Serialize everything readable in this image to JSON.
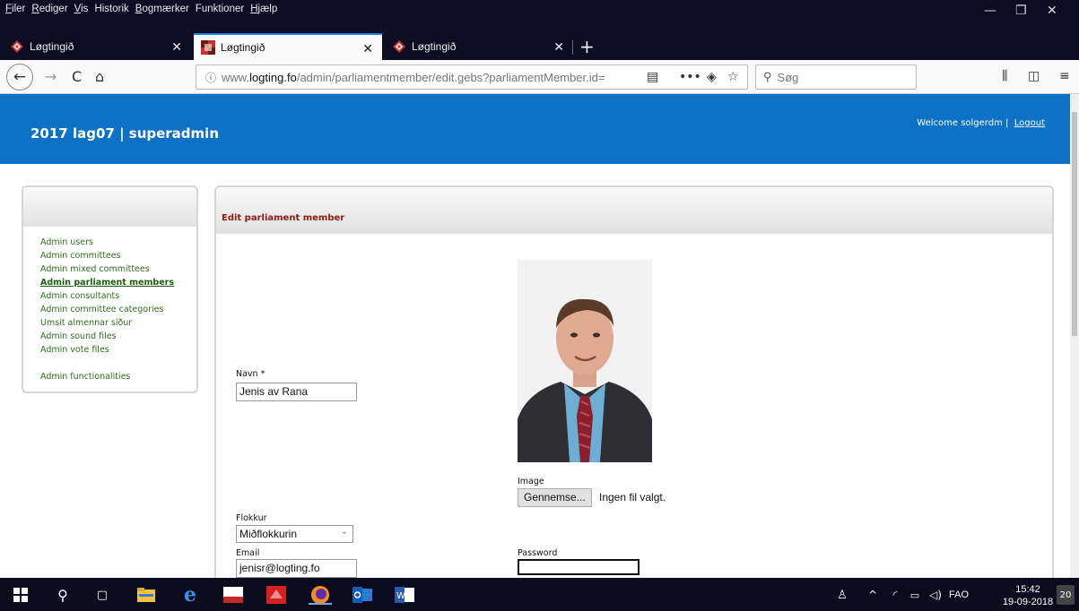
{
  "menubar": {
    "items": [
      {
        "u": "F",
        "rest": "iler"
      },
      {
        "u": "R",
        "rest": "ediger"
      },
      {
        "u": "V",
        "rest": "is"
      },
      {
        "u": "",
        "rest": "Historik"
      },
      {
        "u": "B",
        "rest": "ogmærker"
      },
      {
        "u": "",
        "rest": "Funktioner"
      },
      {
        "u": "H",
        "rest": "jælp"
      }
    ]
  },
  "tabs": [
    {
      "label": "Løgtingið"
    },
    {
      "label": "Løgtingið"
    },
    {
      "label": "Løgtingið"
    }
  ],
  "urlbar": {
    "prefix": "www.",
    "domain": "logting.fo",
    "path": "/admin/parliamentmember/edit.gebs?parliamentMember.id="
  },
  "searchbar": {
    "placeholder": "Søg"
  },
  "site": {
    "title": "2017  lag07 | superadmin",
    "welcome": "Welcome solgerdm |",
    "logout": "Logout"
  },
  "sidebar": {
    "items": [
      "Admin users",
      "Admin committees",
      "Admin mixed committees",
      "Admin parliament members",
      "Admin consultants",
      "Admin committee categories",
      "Umsit almennar síður",
      "Admin sound files",
      "Admin vote files",
      "Admin functionalities"
    ]
  },
  "form": {
    "heading": "Edit parliament member",
    "name_label": "Navn *",
    "name_value": "Jenis av Rana",
    "image_label": "Image",
    "file_button": "Gennemse...",
    "file_status": "Ingen fil valgt.",
    "party_label": "Flokkur",
    "party_value": "Miðflokkurin",
    "email_label": "Email",
    "email_value": "jenisr@logting.fo",
    "password_label": "Password"
  },
  "taskbar": {
    "language": "FAO",
    "time": "15:42",
    "date": "19-09-2018",
    "notifications": "20"
  }
}
